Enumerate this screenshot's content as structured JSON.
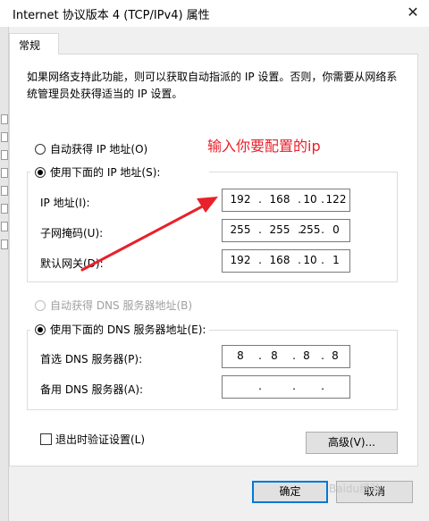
{
  "window": {
    "title": "Internet 协议版本 4 (TCP/IPv4) 属性",
    "close_glyph": "✕"
  },
  "tab": {
    "label": "常规"
  },
  "description": "如果网络支持此功能，则可以获取自动指派的 IP 设置。否则，你需要从网络系统管理员处获得适当的 IP 设置。",
  "ip_section": {
    "auto_label": "自动获得 IP 地址(O)",
    "manual_label": "使用下面的 IP 地址(S):",
    "selected": "manual",
    "ip_address": {
      "label": "IP 地址(I):",
      "octets": [
        "192",
        "168",
        "10",
        "122"
      ]
    },
    "subnet_mask": {
      "label": "子网掩码(U):",
      "octets": [
        "255",
        "255",
        "255",
        "0"
      ]
    },
    "gateway": {
      "label": "默认网关(D):",
      "octets": [
        "192",
        "168",
        "10",
        "1"
      ]
    }
  },
  "dns_section": {
    "auto_label": "自动获得 DNS 服务器地址(B)",
    "manual_label": "使用下面的 DNS 服务器地址(E):",
    "selected": "manual",
    "preferred": {
      "label": "首选 DNS 服务器(P):",
      "octets": [
        "8",
        "8",
        "8",
        "8"
      ]
    },
    "alternate": {
      "label": "备用 DNS 服务器(A):",
      "octets": [
        "",
        "",
        "",
        ""
      ]
    }
  },
  "validate_on_exit": {
    "label": "退出时验证设置(L)",
    "checked": false
  },
  "buttons": {
    "advanced": "高级(V)...",
    "ok": "确定",
    "cancel": "取消"
  },
  "annotation": {
    "text": "输入你要配置的ip",
    "color": "#e8212b"
  },
  "watermark": "Baidu经验",
  "colors": {
    "accent": "#0078d7",
    "panel": "#ffffff",
    "chrome": "#f0f0f0"
  }
}
